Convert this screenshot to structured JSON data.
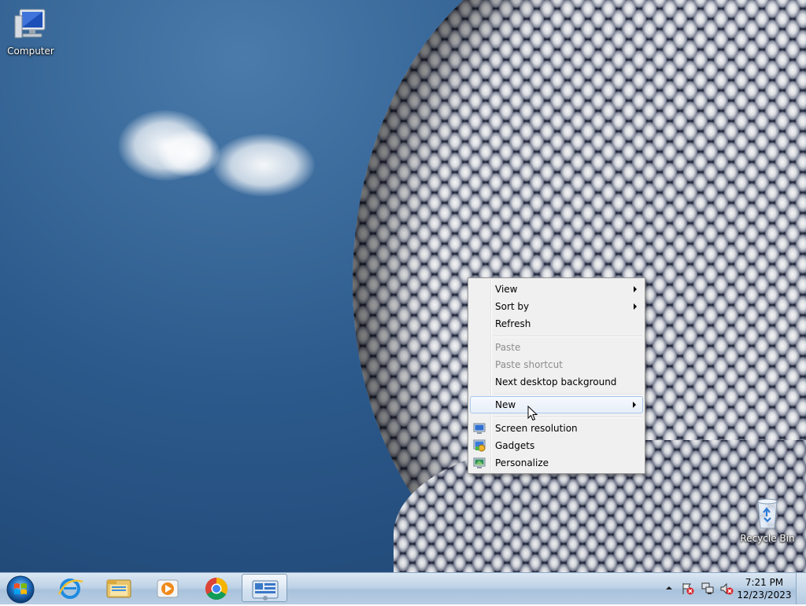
{
  "desktop_icons": {
    "computer": {
      "label": "Computer",
      "icon": "computer-icon"
    },
    "recycle_bin": {
      "label": "Recycle Bin",
      "icon": "recycle-bin-icon"
    }
  },
  "context_menu": {
    "items": [
      {
        "label": "View",
        "submenu": true,
        "enabled": true
      },
      {
        "label": "Sort by",
        "submenu": true,
        "enabled": true
      },
      {
        "label": "Refresh",
        "enabled": true
      },
      {
        "label": "Paste",
        "enabled": false
      },
      {
        "label": "Paste shortcut",
        "enabled": false
      },
      {
        "label": "Next desktop background",
        "enabled": true
      },
      {
        "label": "New",
        "submenu": true,
        "enabled": true,
        "highlighted": true
      },
      {
        "label": "Screen resolution",
        "icon": "screen-resolution-icon",
        "enabled": true
      },
      {
        "label": "Gadgets",
        "icon": "gadgets-icon",
        "enabled": true
      },
      {
        "label": "Personalize",
        "icon": "personalize-icon",
        "enabled": true
      }
    ]
  },
  "taskbar": {
    "pinned": [
      {
        "name": "internet-explorer",
        "icon": "internet-explorer-icon"
      },
      {
        "name": "windows-explorer",
        "icon": "folder-icon"
      },
      {
        "name": "media-player",
        "icon": "media-player-icon"
      },
      {
        "name": "chrome",
        "icon": "chrome-icon"
      },
      {
        "name": "control-panel",
        "icon": "control-panel-icon",
        "active": true
      }
    ],
    "tray": {
      "icons": [
        "show-hidden-icons-icon",
        "action-center-icon",
        "network-icon",
        "volume-muted-icon"
      ],
      "time": "7:21 PM",
      "date": "12/23/2023"
    }
  },
  "colors": {
    "sky": "#2c5a8c",
    "menu_bg": "#f0f0f0",
    "menu_highlight_border": "#a8c8ec",
    "taskbar": "#bed2e6"
  }
}
